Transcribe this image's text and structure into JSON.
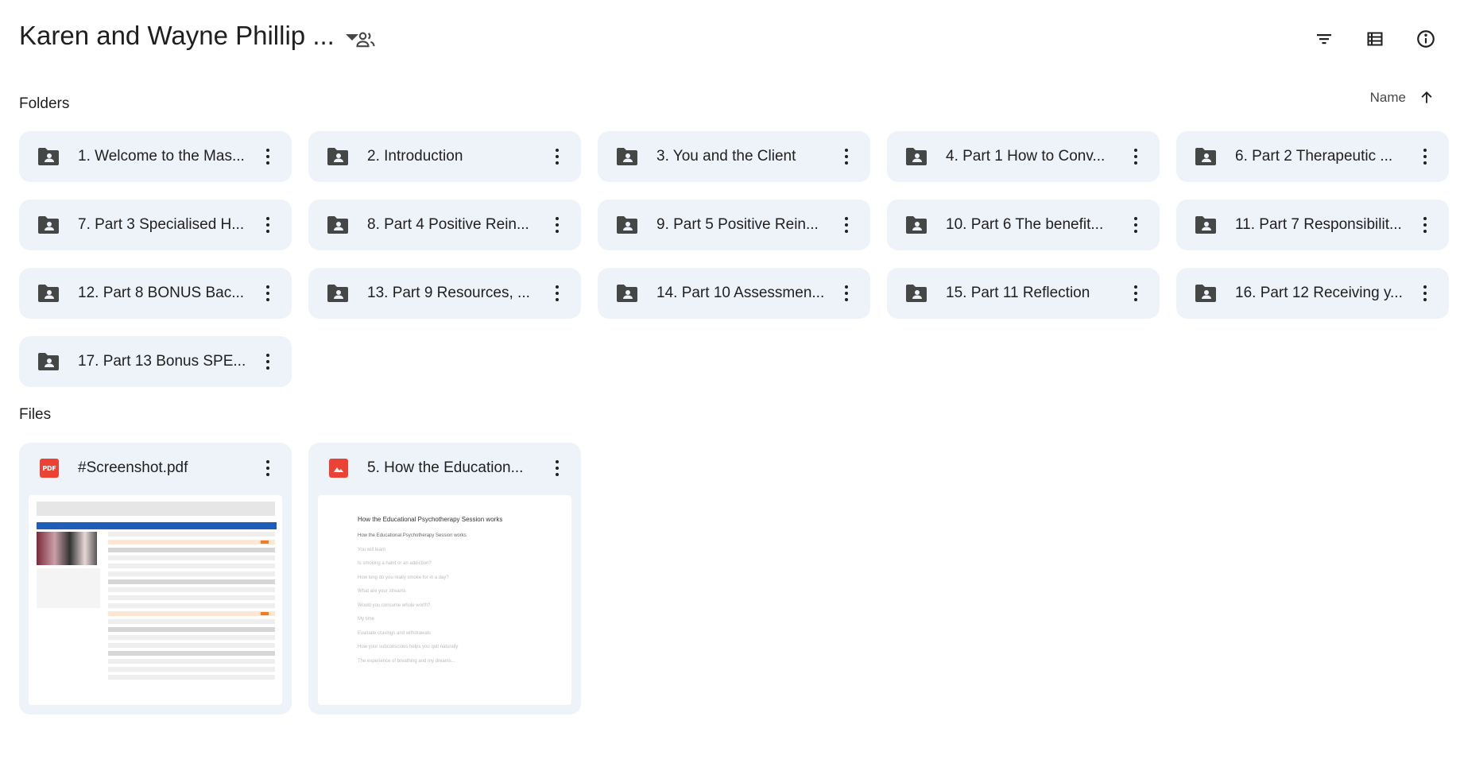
{
  "header": {
    "title": "Karen and Wayne Phillip ...",
    "icons": {
      "dropdown": "caret-down-icon",
      "shared": "people-icon",
      "filter": "filter-icon",
      "list_view": "list-view-icon",
      "details": "info-icon"
    }
  },
  "sections": {
    "folders_label": "Folders",
    "files_label": "Files"
  },
  "sort": {
    "label": "Name",
    "direction_icon": "arrow-up-icon"
  },
  "folders": [
    {
      "name": "1. Welcome to the Mas..."
    },
    {
      "name": "2. Introduction"
    },
    {
      "name": "3. You and the Client"
    },
    {
      "name": "4. Part 1 How to Conv..."
    },
    {
      "name": "6. Part 2 Therapeutic ..."
    },
    {
      "name": "7. Part 3 Specialised H..."
    },
    {
      "name": "8. Part 4 Positive Rein..."
    },
    {
      "name": "9. Part 5 Positive Rein..."
    },
    {
      "name": "10. Part 6 The benefit..."
    },
    {
      "name": "11. Part 7 Responsibilit..."
    },
    {
      "name": "12. Part 8 BONUS Bac..."
    },
    {
      "name": "13. Part 9 Resources, ..."
    },
    {
      "name": "14. Part 10 Assessmen..."
    },
    {
      "name": "15. Part 11 Reflection"
    },
    {
      "name": "16. Part 12 Receiving y..."
    },
    {
      "name": "17. Part 13 Bonus SPE..."
    }
  ],
  "files": [
    {
      "name": "#Screenshot.pdf",
      "type_icon": "pdf-icon",
      "icon_label": "PDF"
    },
    {
      "name": "5. How the Education...",
      "type_icon": "image-icon",
      "preview_title": "How the Educational Psychotherapy Session works",
      "preview_lines": [
        "How the Educational Psychotherapy Session works",
        "You will learn",
        "Is smoking a habit or an addiction?",
        "How long do you really smoke for in a day?",
        "What are your streams",
        "Would you consume whole worth?",
        "My time",
        "Evaluate cravings and withdrawals",
        "How your subconscious helps you quit naturally",
        "The experience of breathing and my dreams..."
      ]
    }
  ],
  "colors": {
    "card_bg": "#eef2f9",
    "folder_icon": "#444746",
    "file_icon_red": "#ea4335",
    "text": "#1f1f1f"
  }
}
